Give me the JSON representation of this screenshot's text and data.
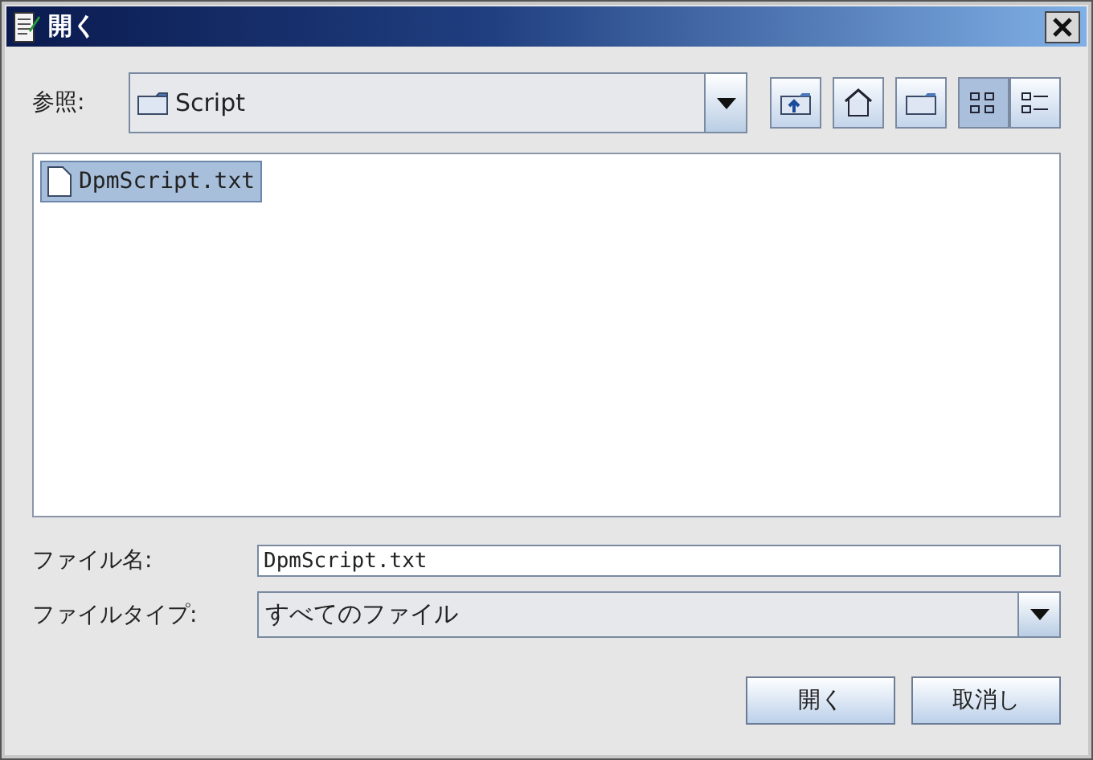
{
  "window": {
    "title": "開く"
  },
  "look_in": {
    "label": "参照:",
    "value": "Script"
  },
  "view_modes": [
    {
      "kind": "list",
      "selected": true
    },
    {
      "kind": "details",
      "selected": false
    }
  ],
  "files": [
    {
      "name": "DpmScript.txt",
      "selected": true
    }
  ],
  "file_name": {
    "label": "ファイル名:",
    "value": "DpmScript.txt"
  },
  "file_type": {
    "label": "ファイルタイプ:",
    "value": "すべてのファイル"
  },
  "buttons": [
    "開く",
    "取消し"
  ]
}
